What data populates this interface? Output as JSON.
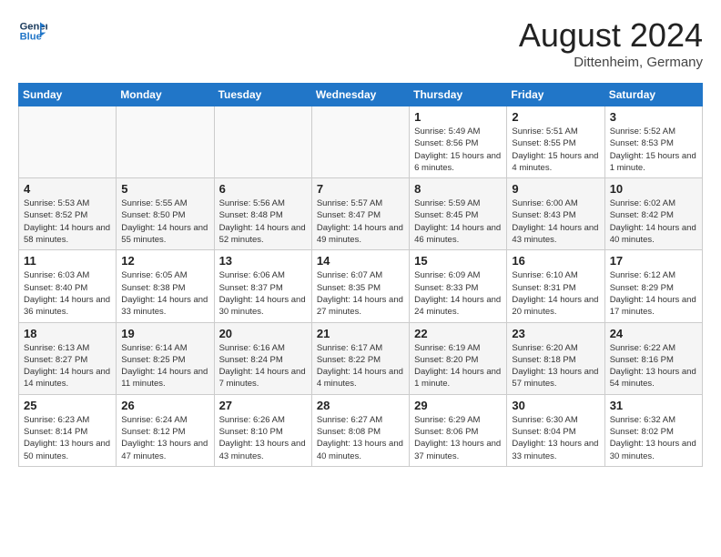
{
  "header": {
    "logo_line1": "General",
    "logo_line2": "Blue",
    "month": "August 2024",
    "location": "Dittenheim, Germany"
  },
  "days_of_week": [
    "Sunday",
    "Monday",
    "Tuesday",
    "Wednesday",
    "Thursday",
    "Friday",
    "Saturday"
  ],
  "weeks": [
    [
      {
        "day": "",
        "content": ""
      },
      {
        "day": "",
        "content": ""
      },
      {
        "day": "",
        "content": ""
      },
      {
        "day": "",
        "content": ""
      },
      {
        "day": "1",
        "content": "Sunrise: 5:49 AM\nSunset: 8:56 PM\nDaylight: 15 hours and 6 minutes."
      },
      {
        "day": "2",
        "content": "Sunrise: 5:51 AM\nSunset: 8:55 PM\nDaylight: 15 hours and 4 minutes."
      },
      {
        "day": "3",
        "content": "Sunrise: 5:52 AM\nSunset: 8:53 PM\nDaylight: 15 hours and 1 minute."
      }
    ],
    [
      {
        "day": "4",
        "content": "Sunrise: 5:53 AM\nSunset: 8:52 PM\nDaylight: 14 hours and 58 minutes."
      },
      {
        "day": "5",
        "content": "Sunrise: 5:55 AM\nSunset: 8:50 PM\nDaylight: 14 hours and 55 minutes."
      },
      {
        "day": "6",
        "content": "Sunrise: 5:56 AM\nSunset: 8:48 PM\nDaylight: 14 hours and 52 minutes."
      },
      {
        "day": "7",
        "content": "Sunrise: 5:57 AM\nSunset: 8:47 PM\nDaylight: 14 hours and 49 minutes."
      },
      {
        "day": "8",
        "content": "Sunrise: 5:59 AM\nSunset: 8:45 PM\nDaylight: 14 hours and 46 minutes."
      },
      {
        "day": "9",
        "content": "Sunrise: 6:00 AM\nSunset: 8:43 PM\nDaylight: 14 hours and 43 minutes."
      },
      {
        "day": "10",
        "content": "Sunrise: 6:02 AM\nSunset: 8:42 PM\nDaylight: 14 hours and 40 minutes."
      }
    ],
    [
      {
        "day": "11",
        "content": "Sunrise: 6:03 AM\nSunset: 8:40 PM\nDaylight: 14 hours and 36 minutes."
      },
      {
        "day": "12",
        "content": "Sunrise: 6:05 AM\nSunset: 8:38 PM\nDaylight: 14 hours and 33 minutes."
      },
      {
        "day": "13",
        "content": "Sunrise: 6:06 AM\nSunset: 8:37 PM\nDaylight: 14 hours and 30 minutes."
      },
      {
        "day": "14",
        "content": "Sunrise: 6:07 AM\nSunset: 8:35 PM\nDaylight: 14 hours and 27 minutes."
      },
      {
        "day": "15",
        "content": "Sunrise: 6:09 AM\nSunset: 8:33 PM\nDaylight: 14 hours and 24 minutes."
      },
      {
        "day": "16",
        "content": "Sunrise: 6:10 AM\nSunset: 8:31 PM\nDaylight: 14 hours and 20 minutes."
      },
      {
        "day": "17",
        "content": "Sunrise: 6:12 AM\nSunset: 8:29 PM\nDaylight: 14 hours and 17 minutes."
      }
    ],
    [
      {
        "day": "18",
        "content": "Sunrise: 6:13 AM\nSunset: 8:27 PM\nDaylight: 14 hours and 14 minutes."
      },
      {
        "day": "19",
        "content": "Sunrise: 6:14 AM\nSunset: 8:25 PM\nDaylight: 14 hours and 11 minutes."
      },
      {
        "day": "20",
        "content": "Sunrise: 6:16 AM\nSunset: 8:24 PM\nDaylight: 14 hours and 7 minutes."
      },
      {
        "day": "21",
        "content": "Sunrise: 6:17 AM\nSunset: 8:22 PM\nDaylight: 14 hours and 4 minutes."
      },
      {
        "day": "22",
        "content": "Sunrise: 6:19 AM\nSunset: 8:20 PM\nDaylight: 14 hours and 1 minute."
      },
      {
        "day": "23",
        "content": "Sunrise: 6:20 AM\nSunset: 8:18 PM\nDaylight: 13 hours and 57 minutes."
      },
      {
        "day": "24",
        "content": "Sunrise: 6:22 AM\nSunset: 8:16 PM\nDaylight: 13 hours and 54 minutes."
      }
    ],
    [
      {
        "day": "25",
        "content": "Sunrise: 6:23 AM\nSunset: 8:14 PM\nDaylight: 13 hours and 50 minutes."
      },
      {
        "day": "26",
        "content": "Sunrise: 6:24 AM\nSunset: 8:12 PM\nDaylight: 13 hours and 47 minutes."
      },
      {
        "day": "27",
        "content": "Sunrise: 6:26 AM\nSunset: 8:10 PM\nDaylight: 13 hours and 43 minutes."
      },
      {
        "day": "28",
        "content": "Sunrise: 6:27 AM\nSunset: 8:08 PM\nDaylight: 13 hours and 40 minutes."
      },
      {
        "day": "29",
        "content": "Sunrise: 6:29 AM\nSunset: 8:06 PM\nDaylight: 13 hours and 37 minutes."
      },
      {
        "day": "30",
        "content": "Sunrise: 6:30 AM\nSunset: 8:04 PM\nDaylight: 13 hours and 33 minutes."
      },
      {
        "day": "31",
        "content": "Sunrise: 6:32 AM\nSunset: 8:02 PM\nDaylight: 13 hours and 30 minutes."
      }
    ]
  ]
}
